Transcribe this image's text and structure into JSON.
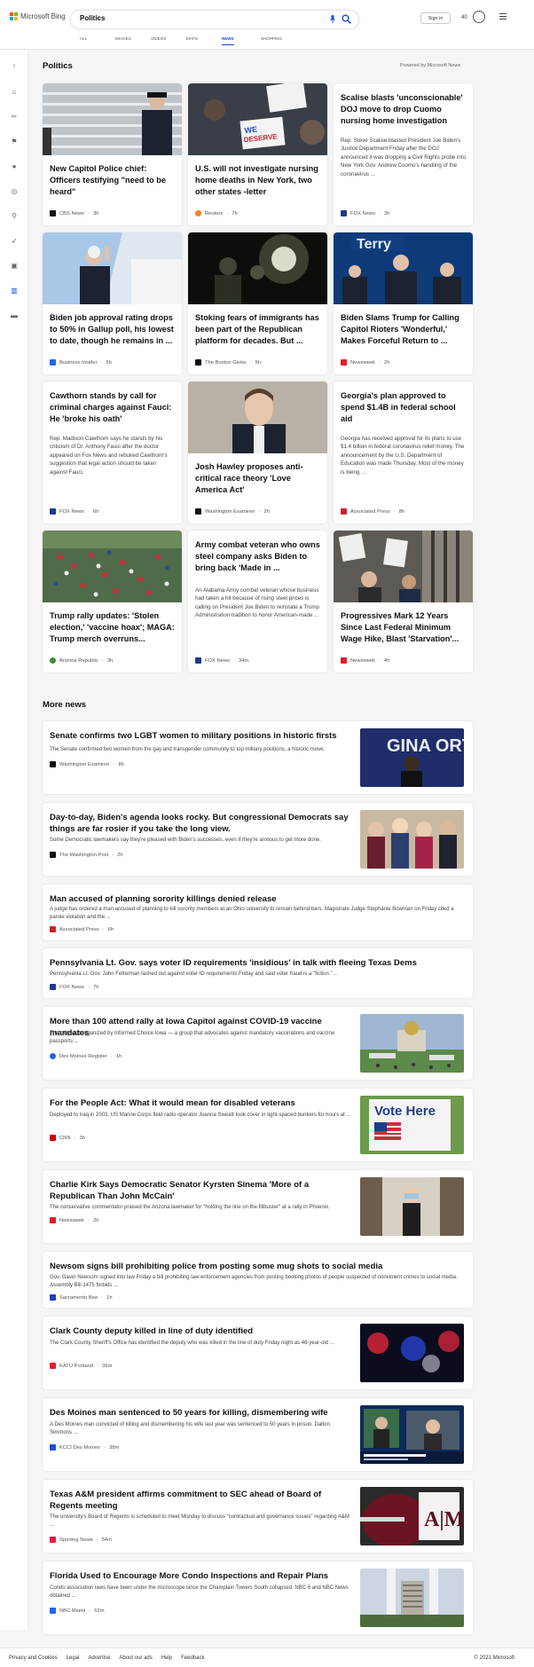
{
  "header": {
    "brand": "Microsoft Bing",
    "search_value": "Politics",
    "tabs": [
      "ALL",
      "IMAGES",
      "VIDEOS",
      "MAPS",
      "NEWS",
      "SHOPPING"
    ],
    "active_tab": "NEWS",
    "signin_label": "Sign in",
    "reward_points": "40",
    "colors": {
      "accent": "#174ae4",
      "logo": [
        "#f25022",
        "#7fba00",
        "#00a4ef",
        "#ffb900"
      ]
    }
  },
  "sidebar": {
    "icons": [
      "chevron-right-icon",
      "home-icon",
      "tools-icon",
      "flag-icon",
      "map-pin-icon",
      "globe-icon",
      "microscope-icon",
      "rocket-icon",
      "film-icon",
      "bank-icon",
      "card-icon"
    ]
  },
  "politics": {
    "title": "Politics",
    "powered_by": "Powered by Microsoft News",
    "cards": [
      {
        "title": "New Capitol Police chief: Officers testifying \"need to be heard\"",
        "summary": "",
        "source": "CBS News",
        "time": "3h",
        "src_color": "#111"
      },
      {
        "title": "U.S. will not investigate nursing home deaths in New York, two other states -letter",
        "summary": "",
        "source": "Reuters",
        "time": "7h",
        "src_color": "#f58220"
      },
      {
        "title": "Scalise blasts 'unconscionable' DOJ move to drop Cuomo nursing home investigation",
        "summary": "Rep. Steve Scalise blasted President Joe Biden's Justice Department Friday after the DOJ announced it was dropping a Civil Rights probe into New York Gov. Andrew Cuomo's handling of the coronavirus ...",
        "source": "FOX News",
        "time": "3h",
        "src_color": "#1e3a8a"
      },
      {
        "title": "Biden job approval rating drops to 50% in Gallup poll, his lowest to date, though he remains in ...",
        "summary": "",
        "source": "Business Insider",
        "time": "5h",
        "src_color": "#2563eb"
      },
      {
        "title": "Stoking fears of immigrants has been part of the Republican platform for decades. But ...",
        "summary": "",
        "source": "The Boston Globe",
        "time": "5h",
        "src_color": "#111"
      },
      {
        "title": "Biden Slams Trump for Calling Capitol Rioters 'Wonderful,' Makes Forceful Return to ...",
        "summary": "",
        "source": "Newsweek",
        "time": "2h",
        "src_color": "#e11d2e"
      },
      {
        "title": "Cawthorn stands by call for criminal charges against Fauci: He 'broke his oath'",
        "summary": "Rep. Madison Cawthorn says he stands by his criticism of Dr. Anthony Fauci after the doctor appeared on Fox News and rebuked Cawthorn's suggestion that legal action should be taken against Fauci.",
        "source": "FOX News",
        "time": "6h",
        "src_color": "#1e3a8a"
      },
      {
        "title": "Josh Hawley proposes anti-critical race theory 'Love America Act'",
        "summary": "",
        "source": "Washington Examiner",
        "time": "2h",
        "src_color": "#111"
      },
      {
        "title": "Georgia's plan approved to spend $1.4B in federal school aid",
        "summary": "Georgia has received approval for its plans to use $1.4 billion in federal coronavirus relief money. The announcement by the U.S. Department of Education was made Thursday. Most of the money is being ...",
        "source": "Associated Press",
        "time": "8h",
        "src_color": "#d11f2f"
      },
      {
        "title": "Trump rally updates: 'Stolen election,' 'vaccine hoax'; MAGA: Trump merch overruns...",
        "summary": "",
        "source": "Arizona Republic",
        "time": "3h",
        "src_color": "#3f8f3f"
      },
      {
        "title": "Army combat veteran who owns steel company asks Biden to bring back 'Made in ...",
        "summary": "An Alabama Army combat veteran whose business had taken a hit because of rising steel prices is calling on President Joe Biden to reinstate a Trump Administration tradition to honor American-made ...",
        "source": "FOX News",
        "time": "34m",
        "src_color": "#1e3a8a"
      },
      {
        "title": "Progressives Mark 12 Years Since Last Federal Minimum Wage Hike, Blast 'Starvation'...",
        "summary": "",
        "source": "Newsweek",
        "time": "4h",
        "src_color": "#e11d2e"
      }
    ]
  },
  "more_news": {
    "title": "More news",
    "items": [
      {
        "title": "Senate confirms two LGBT women to military positions in historic firsts",
        "summary": "The Senate confirmed two women from the gay and transgender community to top military positions, a historic move.",
        "source": "Washington Examiner",
        "time": "8h",
        "src_color": "#111",
        "thumb_text": "GINA ORTIZ JONES"
      },
      {
        "title": "Day-to-day, Biden's agenda looks rocky. But congressional Democrats say things are far rosier if you take the long view.",
        "summary": "Some Democratic lawmakers say they're pleased with Biden's successes, even if they're anxious to get more done.",
        "source": "The Washington Post",
        "time": "2h",
        "src_color": "#111",
        "thumb_text": ""
      },
      {
        "title": "Man accused of planning sorority killings denied release",
        "summary": "A judge has ordered a man accused of planning to kill sorority members at an Ohio university to remain behind bars. Magistrate Judge Stephanie Bowman on Friday cited a parole violation and the ...",
        "source": "Associated Press",
        "time": "6h",
        "src_color": "#d11f2f",
        "thumb_text": ""
      },
      {
        "title": "Pennsylvania Lt. Gov. says voter ID requirements 'insidious' in talk with fleeing Texas Dems",
        "summary": "Pennsylvania Lt. Gov. John Fetterman lashed out against voter ID requirements Friday and said voter fraud is a \"fiction.\" ...",
        "source": "FOX News",
        "time": "7h",
        "src_color": "#1e3a8a",
        "thumb_text": ""
      },
      {
        "title": "More than 100 attend rally at Iowa Capitol against COVID-19 vaccine mandates",
        "summary": "The rally was organized by Informed Choice Iowa — a group that advocates against mandatory vaccinations and vaccine passports ...",
        "source": "Des Moines Register",
        "time": "1h",
        "src_color": "#2563eb",
        "thumb_text": ""
      },
      {
        "title": "For the People Act: What it would mean for disabled veterans",
        "summary": "Deployed to Iraq in 2003, US Marine Corps field radio operator Joanna Sweatt took cover in tight-spaced bunkers for hours at ...",
        "source": "CNN",
        "time": "3h",
        "src_color": "#cc0000",
        "thumb_text": "Vote Here"
      },
      {
        "title": "Charlie Kirk Says Democratic Senator Kyrsten Sinema 'More of a Republican Than John McCain'",
        "summary": "The conservative commentator praised the Arizona lawmaker for \"holding the line on the filibuster\" at a rally in Phoenix.",
        "source": "Newsweek",
        "time": "2h",
        "src_color": "#e11d2e",
        "thumb_text": ""
      },
      {
        "title": "Newsom signs bill prohibiting police from posting some mug shots to social media",
        "summary": "Gov. Gavin Newsom signed into law Friday a bill prohibiting law enforcement agencies from posting booking photos of people suspected of nonviolent crimes to social media. Assembly Bill 1475 forbids ...",
        "source": "Sacramento Bee",
        "time": "1h",
        "src_color": "#1e40af",
        "thumb_text": ""
      },
      {
        "title": "Clark County deputy killed in line of duty identified",
        "summary": "The Clark County Sheriff's Office has identified the deputy who was killed in the line of duty Friday night as 46-year-old ...",
        "source": "KATU Portland",
        "time": "36m",
        "src_color": "#e11d2e",
        "thumb_text": ""
      },
      {
        "title": "Des Moines man sentenced to 50 years for killing, dismembering wife",
        "summary": "A Des Moines man convicted of killing and dismembering his wife last year was sentenced to 50 years in prison. Dalton Simmons ...",
        "source": "KCCI Des Moines",
        "time": "38m",
        "src_color": "#1d4ed8",
        "thumb_text": ""
      },
      {
        "title": "Texas A&M president affirms commitment to SEC ahead of Board of Regents meeting",
        "summary": "The university's Board of Regents is scheduled to meet Monday to discuss \"contractual and governance issues\" regarding A&M ...",
        "source": "Sporting News",
        "time": "54m",
        "src_color": "#e11d48",
        "thumb_text": "A|M"
      },
      {
        "title": "Florida Used to Encourage More Condo Inspections and Repair Plans",
        "summary": "Condo association laws have been under the microscope since the Champlain Towers South collapsed. NBC 6 and NBC News obtained ...",
        "source": "NBC Miami",
        "time": "52m",
        "src_color": "#2563eb",
        "thumb_text": ""
      }
    ]
  },
  "footer": {
    "links": [
      "Privacy and Cookies",
      "Legal",
      "Advertise",
      "About our ads",
      "Help",
      "Feedback"
    ],
    "copyright": "© 2021 Microsoft"
  }
}
